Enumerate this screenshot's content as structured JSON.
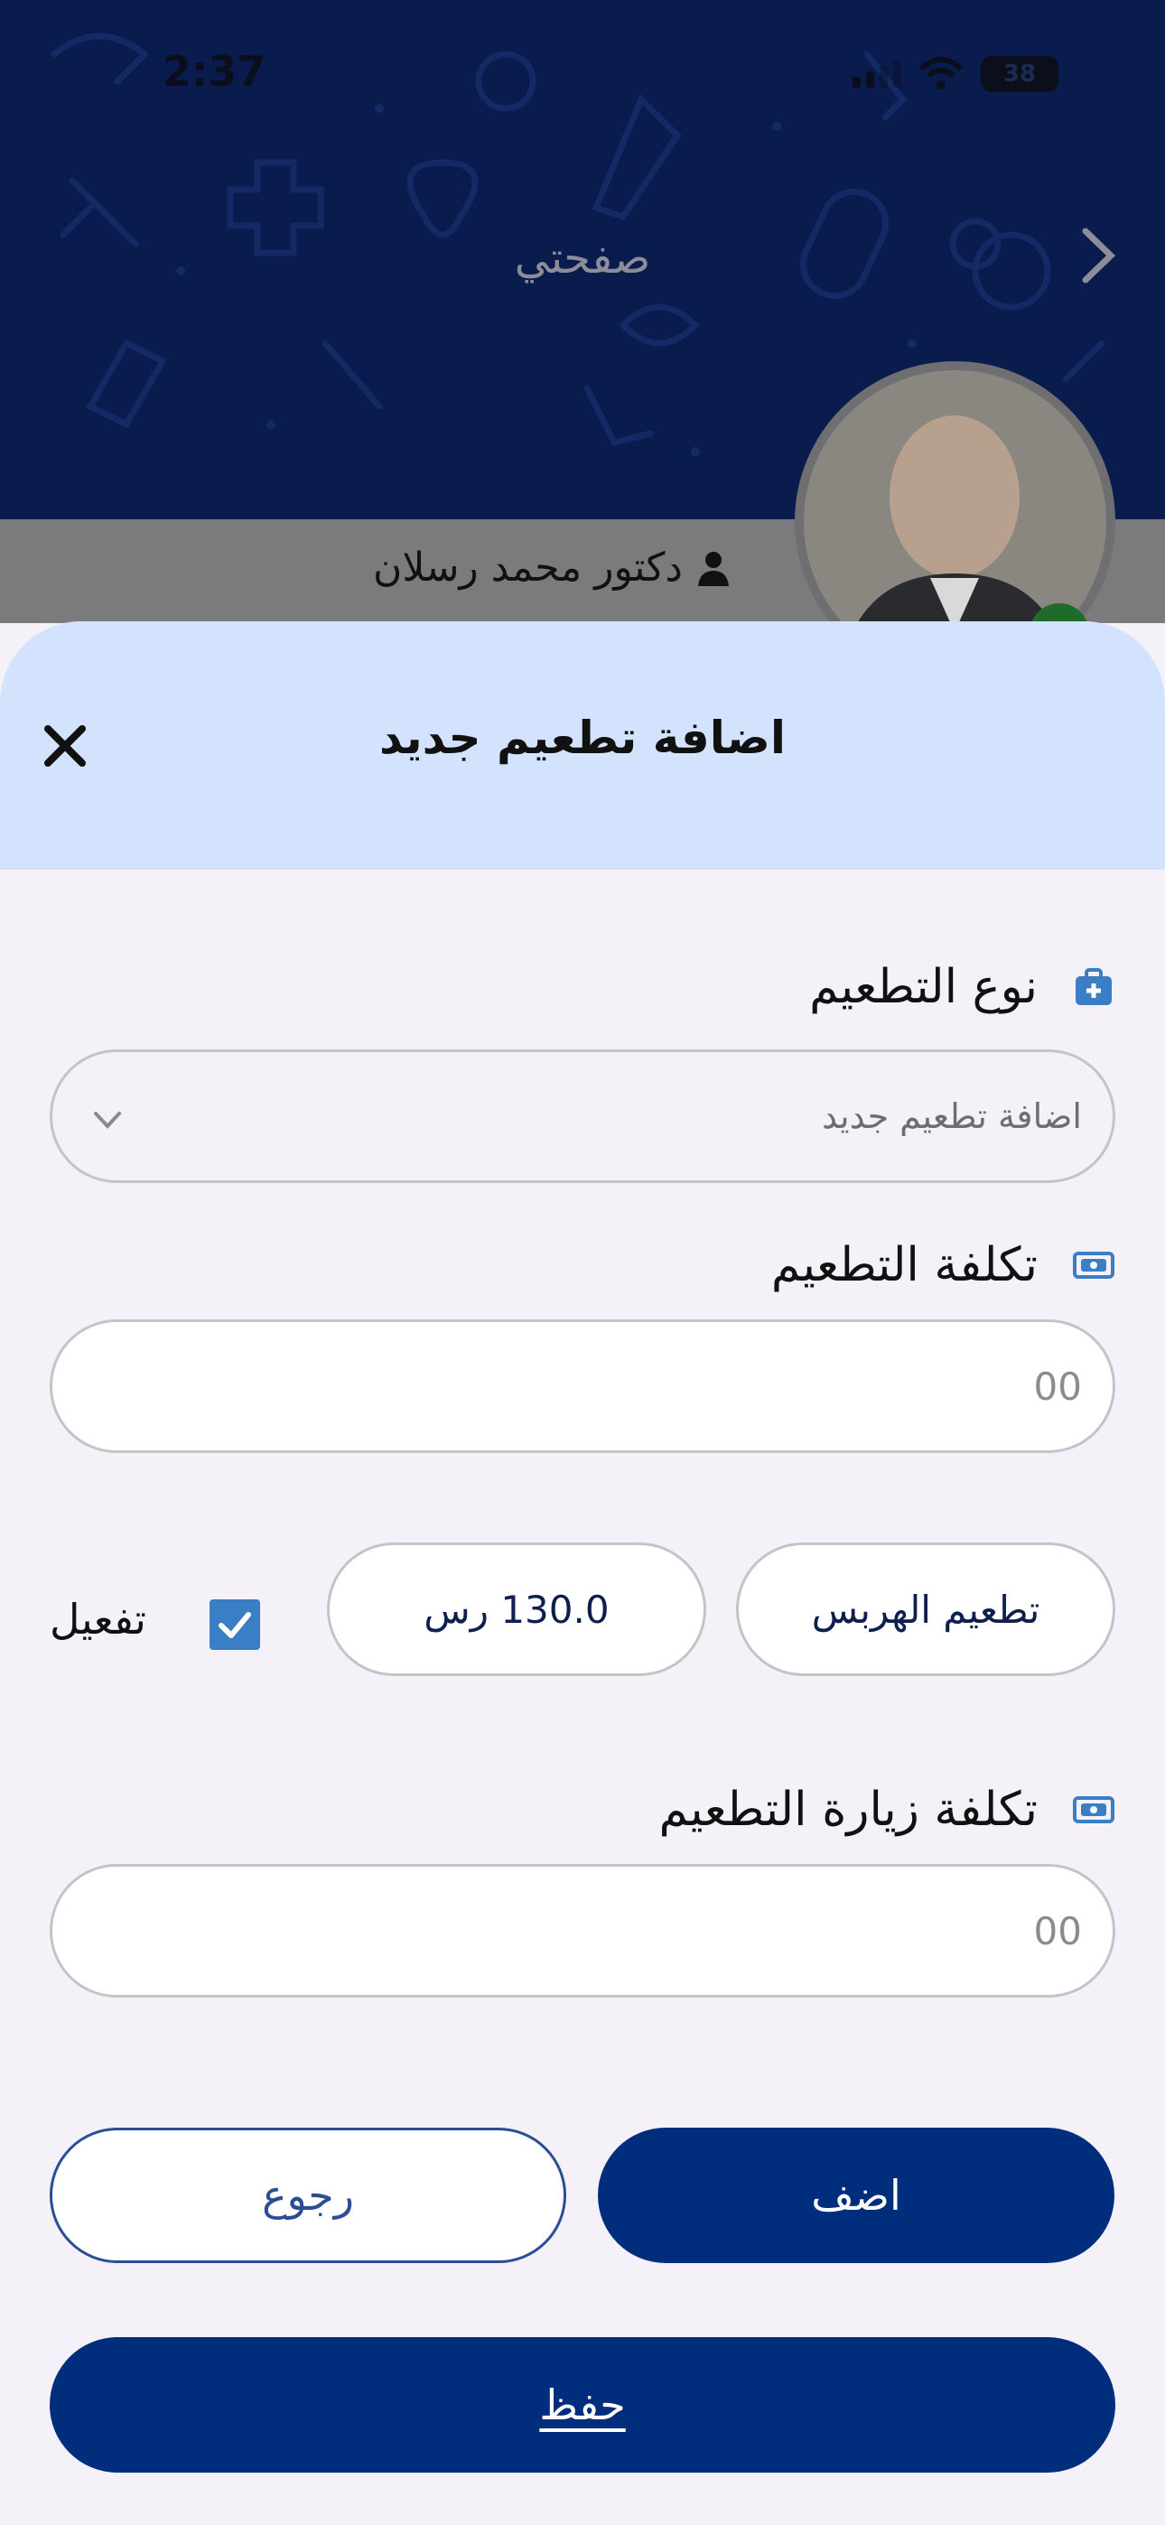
{
  "status_bar": {
    "time": "2:37",
    "battery": "38"
  },
  "background_page": {
    "title": "صفحتي",
    "doctor_name": "دكتور محمد رسلان"
  },
  "modal": {
    "title": "اضافة تطعيم جديد",
    "vaccine_type": {
      "label": "نوع التطعيم",
      "selected": "اضافة تطعيم جديد"
    },
    "vaccine_cost": {
      "label": "تكلفة التطعيم",
      "placeholder": "00"
    },
    "entry": {
      "name": "تطعيم الهربس",
      "price": "130.0 رس",
      "activate_label": "تفعيل",
      "activated": true
    },
    "visit_cost": {
      "label": "تكلفة زيارة التطعيم",
      "placeholder": "00"
    },
    "buttons": {
      "add": "اضف",
      "back": "رجوع",
      "save": "حفظ"
    }
  },
  "colors": {
    "primary": "#002e7c",
    "header_bg": "#d3e2fd",
    "checkbox": "#3a7fc6",
    "page_bg": "#f5f1f9"
  }
}
